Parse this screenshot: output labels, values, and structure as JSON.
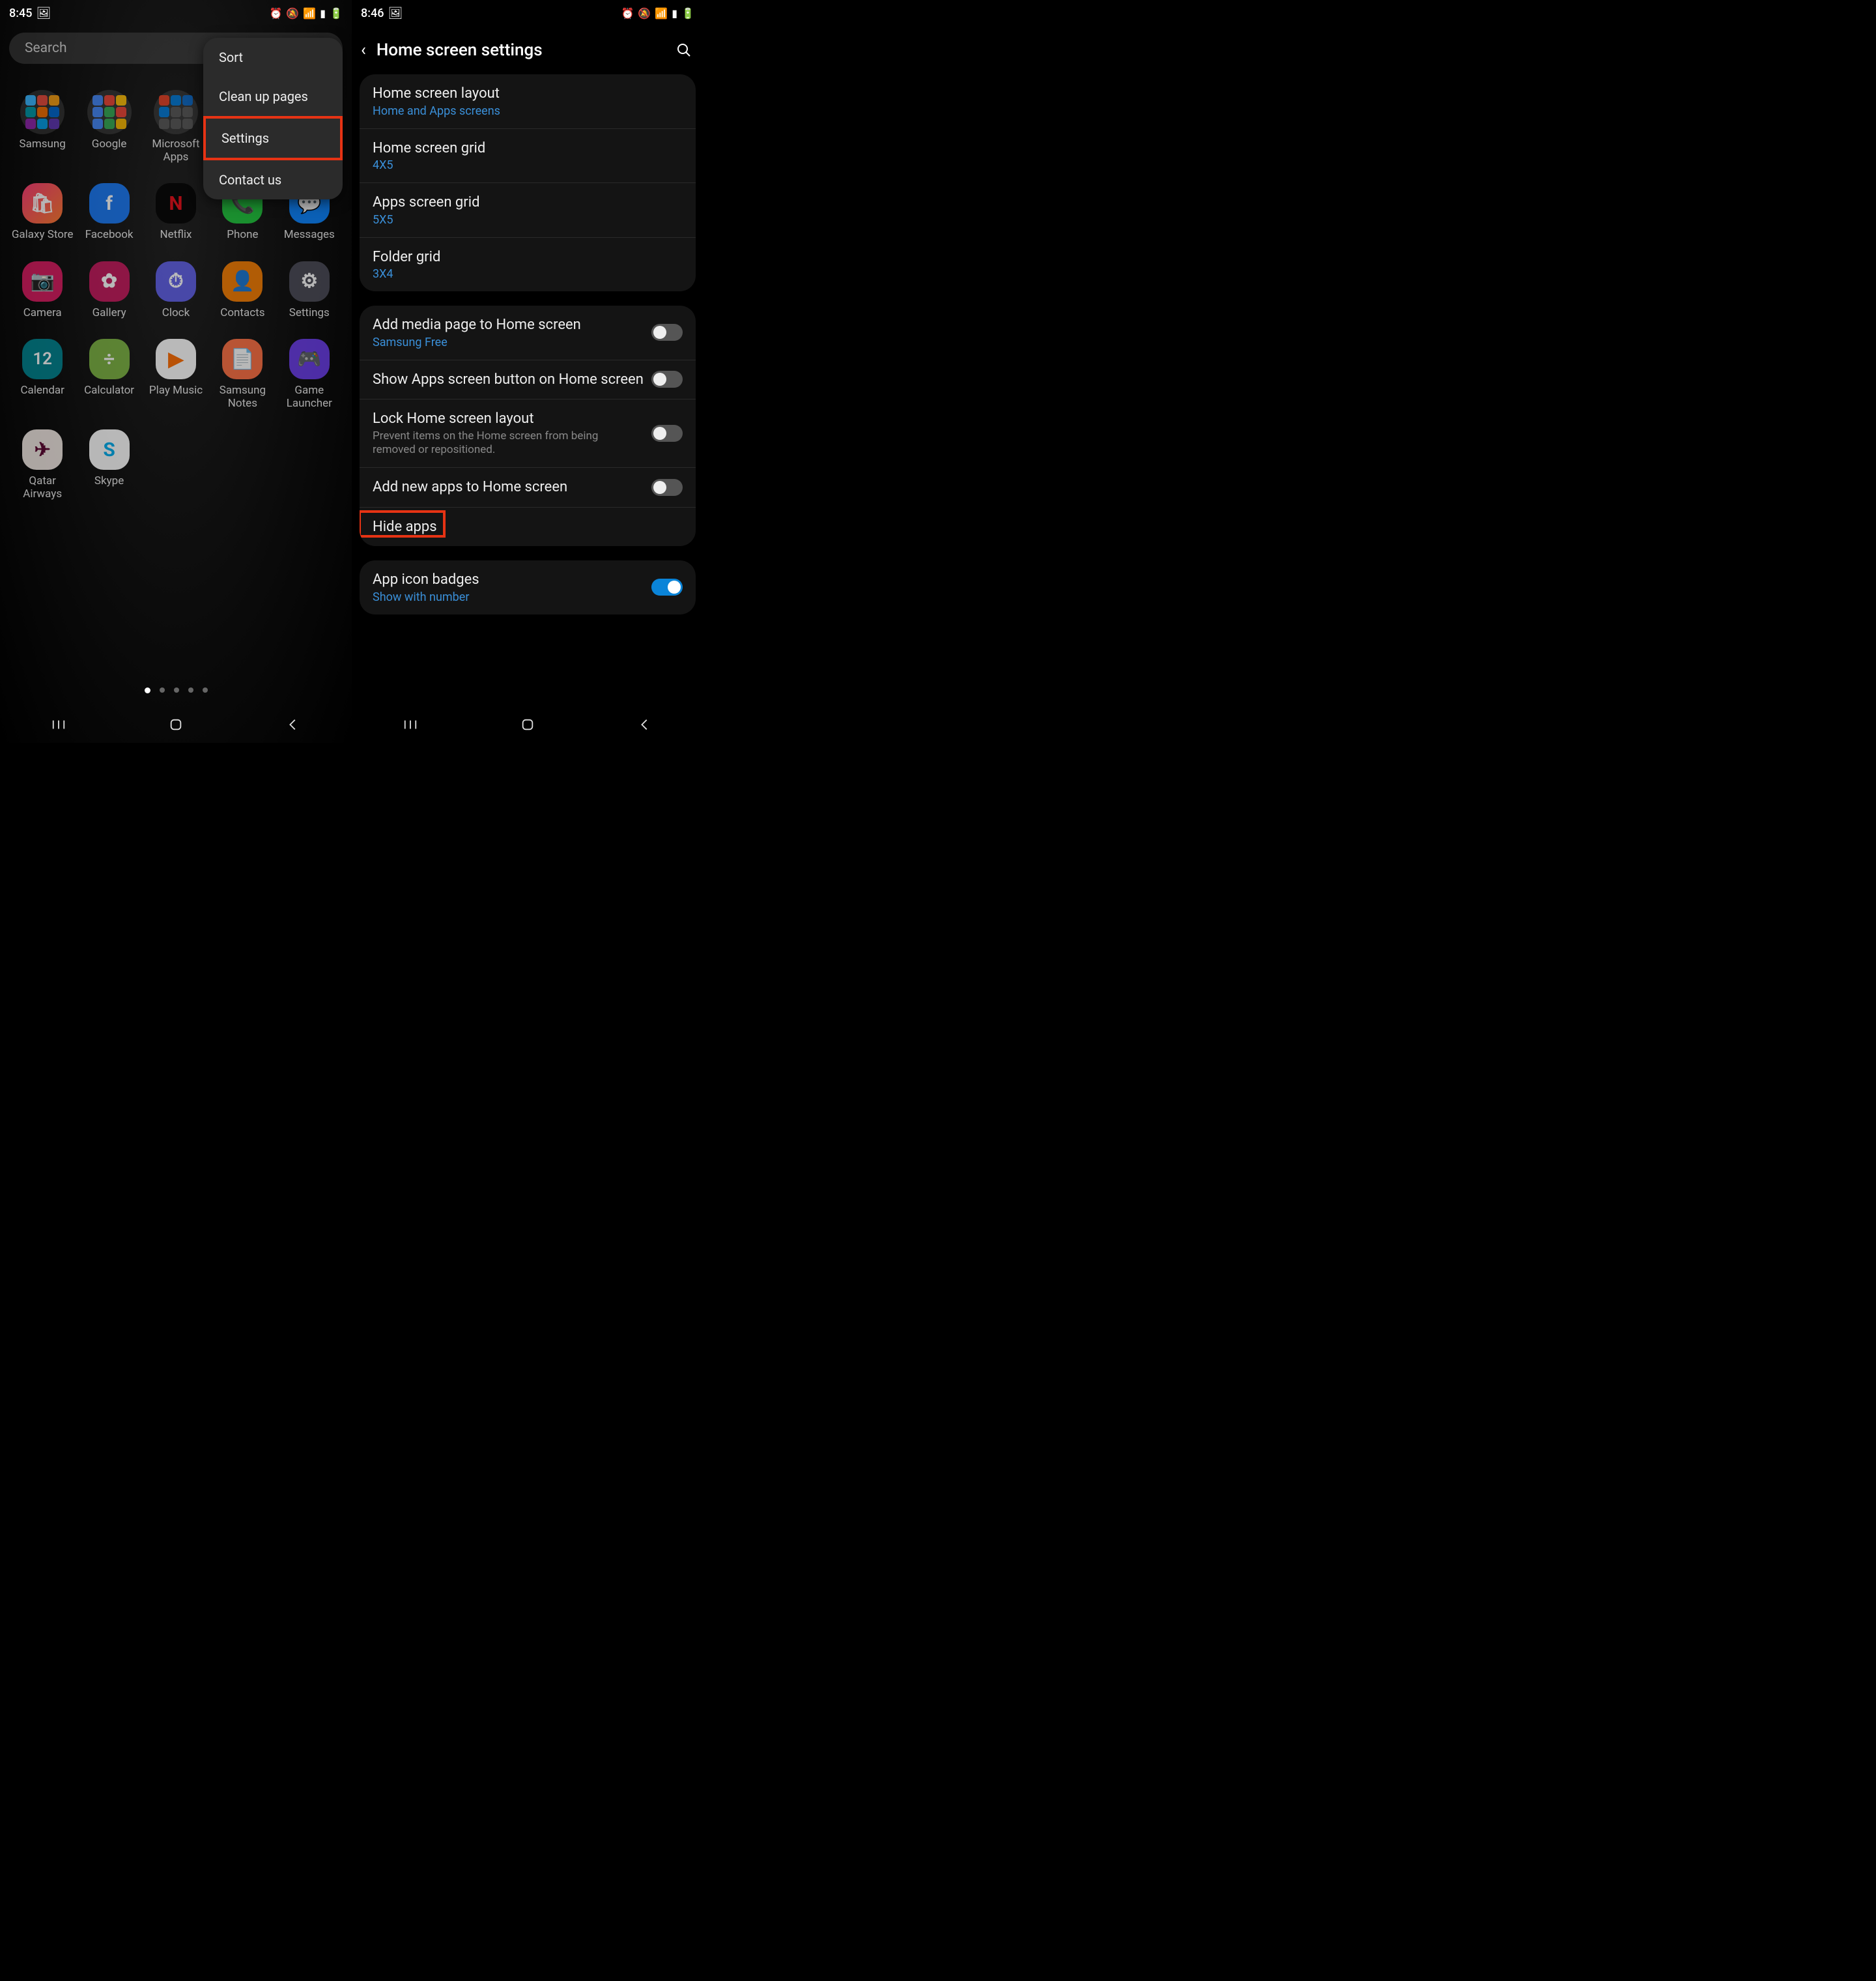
{
  "left": {
    "status": {
      "time": "8:45",
      "icons": [
        "⏰",
        "🔕",
        "📶",
        "📶",
        "🔋"
      ]
    },
    "search_placeholder": "Search",
    "popup": [
      "Sort",
      "Clean up pages",
      "Settings",
      "Contact us"
    ],
    "popup_highlight_index": 2,
    "apps": [
      {
        "label": "Samsung",
        "type": "folder",
        "colors": [
          "#38b6ff",
          "#e64a3c",
          "#f39c12",
          "#0097a7",
          "#ef6c00",
          "#0066cc",
          "#8e24aa",
          "#039be5",
          "#5e35b1"
        ]
      },
      {
        "label": "Google",
        "type": "folder",
        "colors": [
          "#4285f4",
          "#ea4335",
          "#fbbc05",
          "#4285f4",
          "#34a853",
          "#ea4335",
          "#4285f4",
          "#34a853",
          "#f4b400"
        ]
      },
      {
        "label": "Microsoft Apps",
        "type": "folder",
        "colors": [
          "#e23f23",
          "#0078d4",
          "#0a66c2",
          "#0078d4",
          "#555",
          "#555",
          "#555",
          "#555",
          "#555"
        ]
      },
      {
        "label": "",
        "type": "empty"
      },
      {
        "label": "",
        "type": "empty"
      },
      {
        "label": "Galaxy Store",
        "type": "app",
        "bg": "linear-gradient(135deg,#ff3c78,#ff7b2e)",
        "glyph": "🛍"
      },
      {
        "label": "Facebook",
        "type": "app",
        "bg": "#1877f2",
        "glyph": "f"
      },
      {
        "label": "Netflix",
        "type": "app",
        "bg": "#000",
        "glyph": "N",
        "glyphColor": "#e50914"
      },
      {
        "label": "Phone",
        "type": "app",
        "bg": "#1ec43b",
        "glyph": "📞"
      },
      {
        "label": "Messages",
        "type": "app",
        "bg": "#0b84ff",
        "glyph": "💬"
      },
      {
        "label": "Camera",
        "type": "app",
        "bg": "#d81b60",
        "glyph": "📷"
      },
      {
        "label": "Gallery",
        "type": "app",
        "bg": "#c2185b",
        "glyph": "✿"
      },
      {
        "label": "Clock",
        "type": "app",
        "bg": "#5e5ee6",
        "glyph": "⏱"
      },
      {
        "label": "Contacts",
        "type": "app",
        "bg": "#f57c00",
        "glyph": "👤"
      },
      {
        "label": "Settings",
        "type": "app",
        "bg": "#4b4b57",
        "glyph": "⚙"
      },
      {
        "label": "Calendar",
        "type": "app",
        "bg": "#00838f",
        "glyph": "12"
      },
      {
        "label": "Calculator",
        "type": "app",
        "bg": "#7cb342",
        "glyph": "÷"
      },
      {
        "label": "Play Music",
        "type": "app",
        "bg": "#fff",
        "glyph": "▶",
        "glyphColor": "#ff6d00"
      },
      {
        "label": "Samsung Notes",
        "type": "app",
        "bg": "#ff7043",
        "glyph": "📄"
      },
      {
        "label": "Game Launcher",
        "type": "app",
        "bg": "#6a3de8",
        "glyph": "🎮"
      },
      {
        "label": "Qatar Airways",
        "type": "app",
        "bg": "#f2e9e4",
        "glyph": "✈",
        "glyphColor": "#5c0632"
      },
      {
        "label": "Skype",
        "type": "app",
        "bg": "#fff",
        "glyph": "S",
        "glyphColor": "#00aff0"
      }
    ],
    "page_count": 5,
    "active_page": 0
  },
  "right": {
    "status": {
      "time": "8:46",
      "icons": [
        "⏰",
        "🔕",
        "📶",
        "📶",
        "🔋"
      ]
    },
    "title": "Home screen settings",
    "card1": [
      {
        "title": "Home screen layout",
        "sub": "Home and Apps screens",
        "subBlue": true
      },
      {
        "title": "Home screen grid",
        "sub": "4X5",
        "subBlue": true
      },
      {
        "title": "Apps screen grid",
        "sub": "5X5",
        "subBlue": true
      },
      {
        "title": "Folder grid",
        "sub": "3X4",
        "subBlue": true
      }
    ],
    "card2": [
      {
        "title": "Add media page to Home screen",
        "sub": "Samsung Free",
        "subBlue": true,
        "toggle": false
      },
      {
        "title": "Show Apps screen button on Home screen",
        "toggle": false
      },
      {
        "title": "Lock Home screen layout",
        "sub": "Prevent items on the Home screen from being removed or repositioned.",
        "subBlue": false,
        "toggle": false
      },
      {
        "title": "Add new apps to Home screen",
        "toggle": false
      },
      {
        "title": "Hide apps",
        "highlight": true
      }
    ],
    "card3": [
      {
        "title": "App icon badges",
        "sub": "Show with number",
        "subBlue": true,
        "toggle": true
      }
    ]
  }
}
